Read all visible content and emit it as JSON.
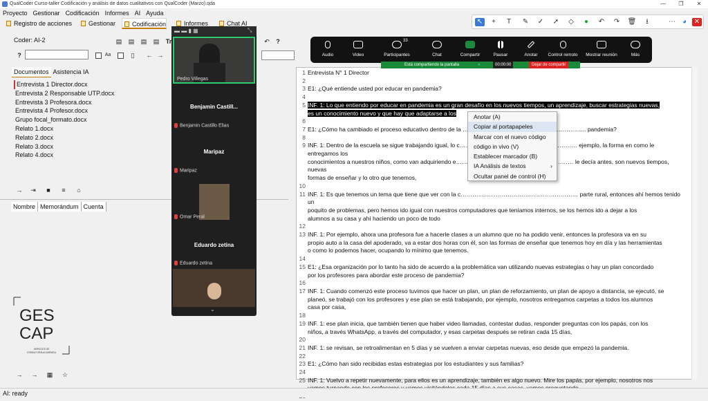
{
  "window": {
    "title": "QualCoder Curso-taller Codificación y análisis de datos cualitativos con QualCoder (Marzo).qda"
  },
  "menu": [
    "Proyecto",
    "Gestionar",
    "Codificación",
    "Informes",
    "AI",
    "Ayuda"
  ],
  "tabs": [
    "Registro de acciones",
    "Gestionar",
    "Codificación",
    "Informes",
    "Chat AI"
  ],
  "coder": "Coder: AI-2",
  "left_tabs": [
    "Documentos",
    "Asistencia IA"
  ],
  "documents": [
    "Entrevista 1 Director.docx",
    "Entrevista 2 Responsable UTP.docx",
    "Entrevista 3 Profesora.docx",
    "Entrevista 4 Profesor.docx",
    "Grupo focal_formato.docx",
    "Relato 1.docx",
    "Relato 2.docx",
    "Relato 3.docx",
    "Relato 4.docx"
  ],
  "columns": [
    "Nombre",
    "Memorándum",
    "Cuenta"
  ],
  "logo": {
    "line1": "GES",
    "line2": "CAP",
    "sub1": "SERVICIOS DE",
    "sub2": "CONSULTORÍA ACADÉMICA"
  },
  "zoom": {
    "participants": [
      "Pedro Villegas",
      "Benjamin  Castill...",
      "Benjamin Castillo Elias",
      "Maripaz",
      "Maripaz",
      "Omar Peral",
      "Eduardo zetina",
      "Eduardo zetina"
    ],
    "toolbar": [
      "Audio",
      "Video",
      "Participantes",
      "Chat",
      "Compartir",
      "Pausar",
      "Anotar",
      "Control remoto",
      "Mostrar reunión",
      "Más"
    ],
    "participant_count": "33",
    "share_status": "Está compartiendo la pantalla",
    "timer": "00:00:00",
    "stop_share": "Dejar de compartir"
  },
  "editor": {
    "lines": [
      {
        "n": "1",
        "t": "Entrevista N° 1 Director"
      },
      {
        "n": "2",
        "t": ""
      },
      {
        "n": "3",
        "t": "E1: ¿Qué entiende usted por educar en pandemia?"
      },
      {
        "n": "4",
        "t": ""
      },
      {
        "n": "5",
        "t": "INF. 1: Lo que entiendo por educar en pandemia es un gran desafío en los nuevos tiempos, un aprendizaje, buscar estrategias nuevas,",
        "hl": true
      },
      {
        "n": "",
        "t": "es un conocimiento nuevo y que hay que adaptarse a los",
        "hl": true
      },
      {
        "n": "6",
        "t": ""
      },
      {
        "n": "7",
        "t": "E1: ¿Cómo ha cambiado el proceso educativo dentro de la ……………………………………………………… pandemia?"
      },
      {
        "n": "8",
        "t": ""
      },
      {
        "n": "9",
        "t": "INF. 1: Dentro de la escuela se sigue trabajando igual, lo c…………………………………………………… ejemplo, la forma en como le entregamos los"
      },
      {
        "n": "",
        "t": "conocimientos a nuestros niños, como van adquiriendo e…………………………………………………… le decía antes, son nuevos tiempos, nuevas"
      },
      {
        "n": "",
        "t": "formas de enseñar y lo otro que tenemos,"
      },
      {
        "n": "10",
        "t": ""
      },
      {
        "n": "11",
        "t": "INF. 1: Es que tenemos un tema que tiene que ver con la c…………………………………………………… parte rural, entonces ahí hemos tenido un"
      },
      {
        "n": "",
        "t": "poquito de problemas, pero hemos ido igual con nuestros computadores que teníamos internos, se los hemos ido a dejar a los"
      },
      {
        "n": "",
        "t": "alumnos a su casa y ahí haciendo un poco de todo"
      },
      {
        "n": "12",
        "t": ""
      },
      {
        "n": "13",
        "t": "INF. 1: Por ejemplo, ahora una profesora fue a hacerle clases a un alumno que no ha podido venir, entonces la profesora va en su"
      },
      {
        "n": "",
        "t": "propio auto a la casa del apoderado, va a estar dos horas con él, son las formas de enseñar que tenemos hoy en día y las herramientas"
      },
      {
        "n": "",
        "t": "o como lo podemos hacer, ocupando lo mínimo que tenemos."
      },
      {
        "n": "14",
        "t": ""
      },
      {
        "n": "15",
        "t": "E1: ¿Esa organización por lo tanto ha sido de acuerdo a la problemática van utilizando nuevas estrategias o hay un plan concordado"
      },
      {
        "n": "",
        "t": "por los profesores para abordar este proceso de pandemia?"
      },
      {
        "n": "16",
        "t": ""
      },
      {
        "n": "17",
        "t": "INF. 1: Cuando comenzó este proceso tuvimos que hacer un plan, un plan de reforzamiento, un plan de apoyo a distancia, se ejecutó, se"
      },
      {
        "n": "",
        "t": "planeó, se trabajó con los profesores y ese plan se está trabajando, por ejemplo, nosotros entregamos carpetas a todos los alumnos"
      },
      {
        "n": "",
        "t": "casa por casa,"
      },
      {
        "n": "18",
        "t": ""
      },
      {
        "n": "19",
        "t": "INF. 1:  ese plan inicia, que también tienen que haber video llamadas, contestar dudas, responder preguntas con los papás, con los"
      },
      {
        "n": "",
        "t": "niños, a través WhatsApp, a través del computador, y esas carpetas después se retiran cada 15 días,"
      },
      {
        "n": "20",
        "t": ""
      },
      {
        "n": "21",
        "t": "INF. 1: se revisan, se retroalimentan en 5 días y se vuelven a enviar carpetas nuevas, eso desde que empezó la pandemia."
      },
      {
        "n": "22",
        "t": ""
      },
      {
        "n": "23",
        "t": "E1: ¿Cómo han sido recibidas estas estrategias por los estudiantes y sus familias?"
      },
      {
        "n": "24",
        "t": ""
      },
      {
        "n": "25",
        "t": "INF. 1: Vuelvo a repetir nuevamente, para ellos es un aprendizaje, también es algo nuevo. Mire los papás, por ejemplo, nosotros nos"
      },
      {
        "n": "",
        "t": "vamos turnando con los profesores y vamos visitándolos cada 15 días a sus casas, vamos preguntando,"
      },
      {
        "n": "26",
        "t": ""
      }
    ]
  },
  "context_menu": [
    "Anotar (A)",
    "Copiar al portapapeles",
    "Marcar con el nuevo código",
    "código in vivo (V)",
    "Establecer marcador (B)",
    "IA Análisis de textos",
    "Ocultar panel de control (H)"
  ],
  "status": "AI: ready",
  "colors": {
    "accent": "#c87a00",
    "zoom_green": "#1a8a3a",
    "zoom_red": "#e04040",
    "share_green": "#2ecc71"
  }
}
